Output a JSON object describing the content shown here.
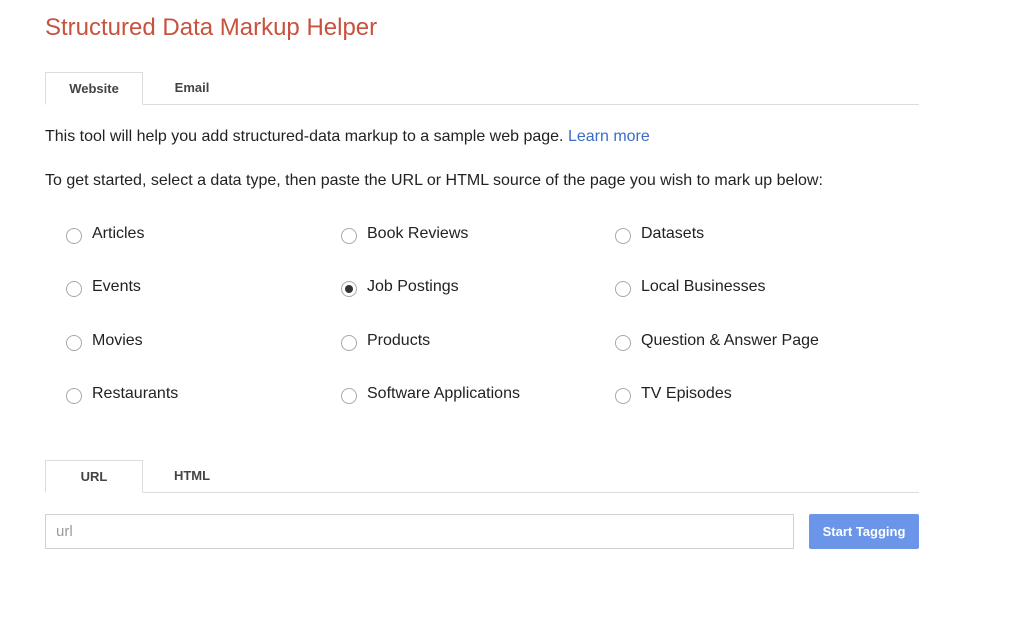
{
  "app": {
    "title": "Structured Data Markup Helper"
  },
  "source_tabs": [
    {
      "label": "Website",
      "active": true
    },
    {
      "label": "Email",
      "active": false
    }
  ],
  "intro": {
    "text": "This tool will help you add structured-data markup to a sample web page. ",
    "link_text": "Learn more"
  },
  "instructions": "To get started, select a data type, then paste the URL or HTML source of the page you wish to mark up below:",
  "data_types": [
    {
      "label": "Articles",
      "checked": false
    },
    {
      "label": "Book Reviews",
      "checked": false
    },
    {
      "label": "Datasets",
      "checked": false
    },
    {
      "label": "Events",
      "checked": false
    },
    {
      "label": "Job Postings",
      "checked": true
    },
    {
      "label": "Local Businesses",
      "checked": false
    },
    {
      "label": "Movies",
      "checked": false
    },
    {
      "label": "Products",
      "checked": false
    },
    {
      "label": "Question & Answer Page",
      "checked": false
    },
    {
      "label": "Restaurants",
      "checked": false
    },
    {
      "label": "Software Applications",
      "checked": false
    },
    {
      "label": "TV Episodes",
      "checked": false
    }
  ],
  "input_tabs": [
    {
      "label": "URL",
      "active": true
    },
    {
      "label": "HTML",
      "active": false
    }
  ],
  "url_input": {
    "value": "",
    "placeholder": "url"
  },
  "start_button": {
    "label": "Start Tagging"
  },
  "colors": {
    "title": "#c8523f",
    "link": "#3b6dc7",
    "button": "#6b95e8"
  }
}
